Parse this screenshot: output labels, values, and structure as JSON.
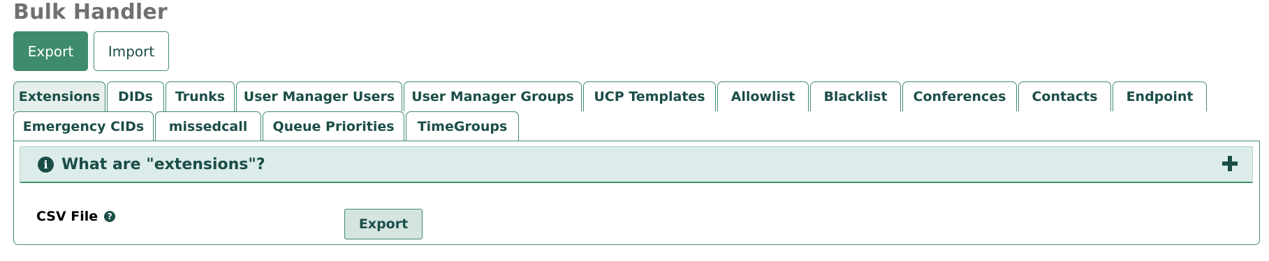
{
  "page": {
    "title": "Bulk Handler"
  },
  "top_buttons": {
    "export_label": "Export",
    "import_label": "Import"
  },
  "tabs_row1": [
    {
      "label": "Extensions"
    },
    {
      "label": "DIDs"
    },
    {
      "label": "Trunks"
    },
    {
      "label": "User Manager Users"
    },
    {
      "label": "User Manager Groups"
    },
    {
      "label": "UCP Templates"
    },
    {
      "label": "Allowlist"
    },
    {
      "label": "Blacklist"
    },
    {
      "label": "Conferences"
    },
    {
      "label": "Contacts"
    },
    {
      "label": "Endpoint"
    }
  ],
  "tabs_row2": [
    {
      "label": "Emergency CIDs"
    },
    {
      "label": "missedcall"
    },
    {
      "label": "Queue Priorities"
    },
    {
      "label": "TimeGroups"
    }
  ],
  "active_tab": "Extensions",
  "info_bar": {
    "icon": "info-circle-icon",
    "text": "What are \"extensions\"?",
    "toggle_icon": "plus-icon"
  },
  "form": {
    "csv_label": "CSV File",
    "help_icon": "question-circle-icon",
    "help_glyph": "?",
    "export_button_label": "Export"
  },
  "colors": {
    "accent": "#3f8b6d",
    "text_dark_teal": "#1b4d47",
    "info_bar_bg": "#dcecea",
    "title_gray": "#707070"
  }
}
